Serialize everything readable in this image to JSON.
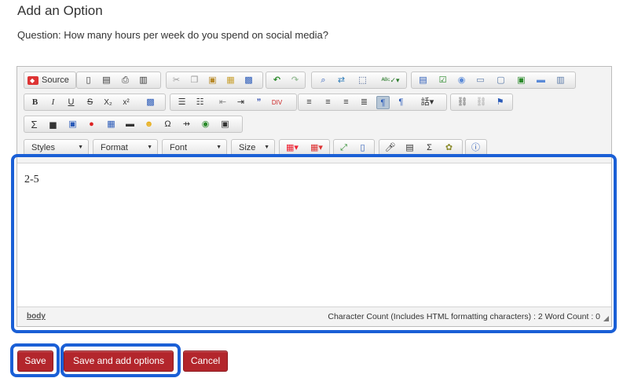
{
  "page": {
    "title": "Add an Option",
    "question": "Question: How many hours per week do you spend on social media?"
  },
  "toolbar": {
    "source_label": "Source",
    "styles_label": "Styles",
    "format_label": "Format",
    "font_label": "Font",
    "size_label": "Size",
    "icons_row1": [
      "new-page-icon",
      "preview-icon",
      "print-icon",
      "templates-icon",
      "cut-icon",
      "copy-icon",
      "paste-icon",
      "paste-text-icon",
      "paste-word-icon",
      "undo-icon",
      "redo-icon",
      "find-icon",
      "replace-icon",
      "select-all-icon",
      "spellcheck-icon",
      "form-icon",
      "checkbox-icon",
      "radio-icon",
      "textfield-icon",
      "textarea-icon",
      "select-icon",
      "button-icon",
      "imagebutton-icon"
    ],
    "icons_row2": [
      "bold-icon",
      "italic-icon",
      "underline-icon",
      "strike-icon",
      "subscript-icon",
      "superscript-icon",
      "remove-format-icon",
      "numbered-list-icon",
      "bulleted-list-icon",
      "outdent-icon",
      "indent-icon",
      "blockquote-icon",
      "div-icon",
      "align-left-icon",
      "align-center-icon",
      "align-right-icon",
      "justify-icon",
      "ltr-icon",
      "rtl-icon",
      "language-icon",
      "link-icon",
      "unlink-icon",
      "anchor-icon"
    ],
    "icons_row3": [
      "math-icon",
      "media-icon",
      "image-icon",
      "flash-icon",
      "table-icon",
      "horizontal-rule-icon",
      "smiley-icon",
      "special-char-icon",
      "page-break-icon",
      "iframe-icon",
      "youtube-icon"
    ],
    "icons_row4": [
      "text-color-icon",
      "bg-color-icon",
      "maximize-icon",
      "show-blocks-icon",
      "audio-icon",
      "video-icon",
      "equation-icon",
      "widget-icon",
      "about-icon"
    ]
  },
  "editor": {
    "content": "2-5",
    "path": "body",
    "counts": "Character Count (Includes HTML formatting characters) : 2 Word Count : 0"
  },
  "buttons": {
    "save": "Save",
    "save_add": "Save and add options",
    "cancel": "Cancel"
  },
  "colors": {
    "button": "#b3262c",
    "highlight": "#1a5fd6"
  }
}
